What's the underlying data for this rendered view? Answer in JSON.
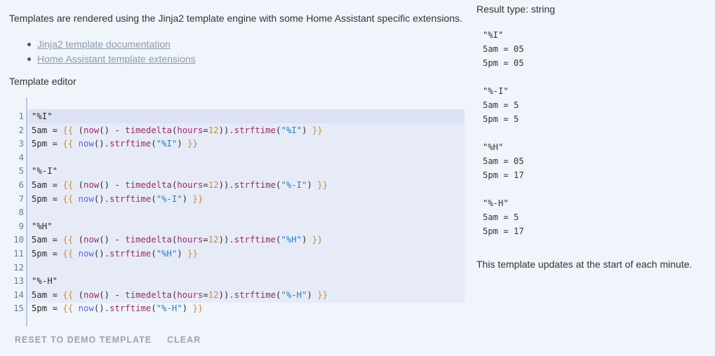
{
  "intro": "Templates are rendered using the Jinja2 template engine with some Home Assistant specific extensions.",
  "links": [
    "Jinja2 template documentation",
    "Home Assistant template extensions"
  ],
  "editor": {
    "label": "Template editor",
    "line_numbers": [
      "1",
      "2",
      "3",
      "4",
      "5",
      "6",
      "7",
      "8",
      "9",
      "10",
      "11",
      "12",
      "13",
      "14",
      "15"
    ]
  },
  "actions": {
    "reset": "RESET TO DEMO TEMPLATE",
    "clear": "CLEAR"
  },
  "result": {
    "type_label": "Result type: string",
    "output_lines": [
      "\"%I\"",
      "5am = 05",
      "5pm = 05",
      "",
      "\"%-I\"",
      "5am = 5",
      "5pm = 5",
      "",
      "\"%H\"",
      "5am = 05",
      "5pm = 17",
      "",
      "\"%-H\"",
      "5am = 5",
      "5pm = 17"
    ],
    "update_note": "This template updates at the start of each minute."
  },
  "code": {
    "l1": "\"%I\"",
    "l2_pre": "5am = ",
    "l2_fmt": "\"%I\"",
    "l3_pre": "5pm = ",
    "l3_fmt": "\"%I\"",
    "l5": "\"%-I\"",
    "l6_pre": "5am = ",
    "l6_fmt": "\"%-I\"",
    "l7_pre": "5pm = ",
    "l7_fmt": "\"%-I\"",
    "l9": "\"%H\"",
    "l10_pre": "5am = ",
    "l10_fmt": "\"%H\"",
    "l11_pre": "5pm = ",
    "l11_fmt": "\"%H\"",
    "l13": "\"%-H\"",
    "l14_pre": "5am = ",
    "l14_fmt": "\"%-H\"",
    "l15_pre": "5pm = ",
    "l15_fmt": "\"%-H\"",
    "open": "{{ ",
    "close": " }}",
    "now_call": "now",
    "paren_open": "(",
    "paren_close": ")",
    "minus": " - ",
    "timedelta": "timedelta",
    "hours_kw": "hours",
    "eq": "=",
    "twelve": "12",
    "strftime": ".strftime",
    "now_parens": "()"
  }
}
